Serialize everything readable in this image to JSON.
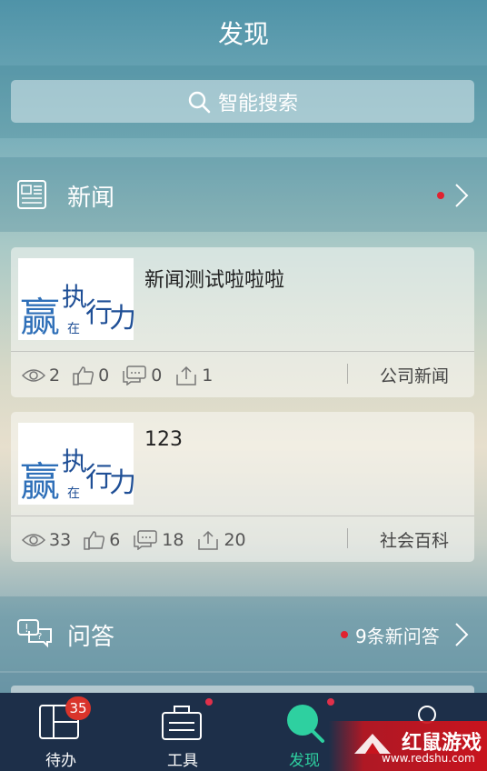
{
  "header": {
    "title": "发现"
  },
  "search": {
    "placeholder": "智能搜索"
  },
  "news_section": {
    "title": "新闻"
  },
  "news": [
    {
      "title": "新闻测试啦啦啦",
      "views": "2",
      "likes": "0",
      "comments": "0",
      "shares": "1",
      "category": "公司新闻"
    },
    {
      "title": "123",
      "views": "33",
      "likes": "6",
      "comments": "18",
      "shares": "20",
      "category": "社会百科"
    }
  ],
  "qa_section": {
    "title": "问答",
    "new_count": "9条新问答"
  },
  "tabs": [
    {
      "label": "待办",
      "badge": "35"
    },
    {
      "label": "工具"
    },
    {
      "label": "发现"
    },
    {
      "label": ""
    }
  ],
  "thumb_text": {
    "a": "赢",
    "b": "执",
    "c": "行",
    "d": "力",
    "e": "在"
  },
  "watermark": {
    "name": "红鼠游戏",
    "url": "www.redshu.com"
  },
  "colors": {
    "active_tab": "#2ed0a0",
    "badge": "#d9342b",
    "tabbar": "#1d2f49",
    "dot": "#e02230"
  }
}
